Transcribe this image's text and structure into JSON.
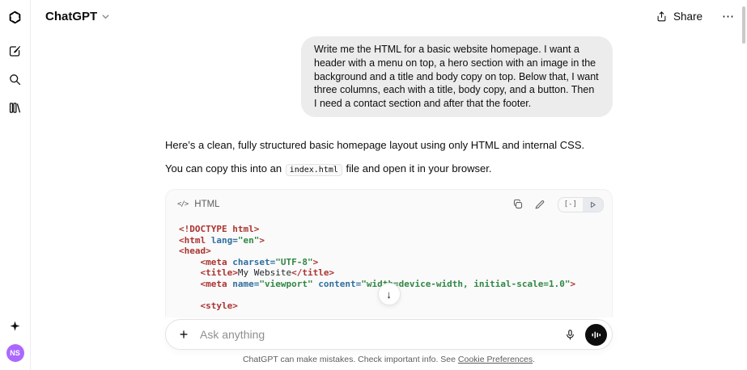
{
  "header": {
    "title": "ChatGPT",
    "share_label": "Share"
  },
  "sidebar": {
    "avatar_initials": "NS",
    "avatar_color": "#ab68ff"
  },
  "conversation": {
    "user_message": "Write me the HTML for a basic website homepage. I want a header with a menu on top, a hero section with an image in the background and a title and body copy on top. Below that, I want three columns, each with a title, body copy, and a button. Then I need a contact section and after that the footer.",
    "assistant_paragraph_1": "Here’s a clean, fully structured basic homepage layout using only HTML and internal CSS.",
    "assistant_paragraph_2_pre": "You can copy this into an ",
    "assistant_paragraph_2_code": "index.html",
    "assistant_paragraph_2_post": " file and open it in your browser."
  },
  "code_block": {
    "language_label": "HTML",
    "syntax_colors": {
      "tag": "#ac3431",
      "meta": "#ac3431",
      "attribute": "#2f6f9f",
      "string": "#2f8744",
      "plain": "#1f2328"
    },
    "lines": [
      [
        {
          "t": "meta",
          "v": "<!DOCTYPE html>"
        }
      ],
      [
        {
          "t": "tag",
          "v": "<html"
        },
        {
          "t": "attr",
          "v": " lang="
        },
        {
          "t": "str",
          "v": "\"en\""
        },
        {
          "t": "tag",
          "v": ">"
        }
      ],
      [
        {
          "t": "tag",
          "v": "<head>"
        }
      ],
      [
        {
          "t": "pln",
          "v": "    "
        },
        {
          "t": "tag",
          "v": "<meta"
        },
        {
          "t": "attr",
          "v": " charset="
        },
        {
          "t": "str",
          "v": "\"UTF-8\""
        },
        {
          "t": "tag",
          "v": ">"
        }
      ],
      [
        {
          "t": "pln",
          "v": "    "
        },
        {
          "t": "tag",
          "v": "<title>"
        },
        {
          "t": "pln",
          "v": "My Website"
        },
        {
          "t": "tag",
          "v": "</title>"
        }
      ],
      [
        {
          "t": "pln",
          "v": "    "
        },
        {
          "t": "tag",
          "v": "<meta"
        },
        {
          "t": "attr",
          "v": " name="
        },
        {
          "t": "str",
          "v": "\"viewport\""
        },
        {
          "t": "attr",
          "v": " content="
        },
        {
          "t": "str",
          "v": "\"width=device-width, initial-scale=1.0\""
        },
        {
          "t": "tag",
          "v": ">"
        }
      ],
      [],
      [
        {
          "t": "pln",
          "v": "    "
        },
        {
          "t": "tag",
          "v": "<style>"
        }
      ]
    ]
  },
  "composer": {
    "placeholder": "Ask anything"
  },
  "footer": {
    "text_pre": "ChatGPT can make mistakes. Check important info. See ",
    "link_text": "Cookie Preferences",
    "text_post": "."
  },
  "glyphs": {
    "plus": "+",
    "ellipsis": "⋯",
    "arrow_down": "↓",
    "code_icon": "</>",
    "code_view": "[-]"
  },
  "icons": [
    "openai-logo",
    "compose-icon",
    "search-icon",
    "library-icon",
    "sparkle-icon",
    "chevron-down-icon",
    "share-upload-icon",
    "ellipsis-icon",
    "code-lang-icon",
    "copy-icon",
    "edit-pencil-icon",
    "code-view-icon",
    "play-icon",
    "scroll-down-arrow-icon",
    "plus-icon",
    "microphone-icon",
    "voice-waveform-icon"
  ]
}
